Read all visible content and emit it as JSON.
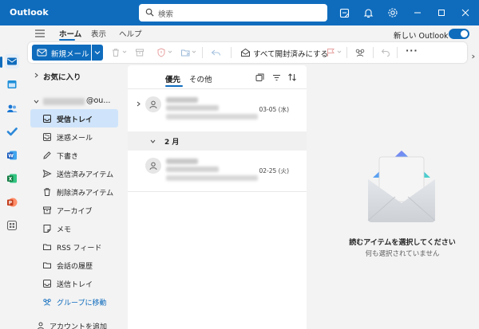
{
  "app": {
    "title": "Outlook"
  },
  "search": {
    "placeholder": "検索"
  },
  "titlebar_icons": [
    "notes-icon",
    "bell-icon",
    "gear-icon"
  ],
  "window_controls": [
    "minimize-icon",
    "maximize-icon",
    "close-icon"
  ],
  "menu": {
    "tabs": [
      {
        "label": "ホーム",
        "active": true
      },
      {
        "label": "表示",
        "active": false
      },
      {
        "label": "ヘルプ",
        "active": false
      }
    ],
    "new_outlook_label": "新しい Outlook",
    "new_outlook_on": true
  },
  "ribbon": {
    "new_mail_label": "新規メール",
    "mark_all_read_label": "すべて開封済みにする",
    "more_label": "···"
  },
  "folders": {
    "favorites_label": "お気に入り",
    "account_suffix": "@ou...",
    "items": [
      {
        "label": "受信トレイ",
        "icon": "inbox-icon",
        "selected": true
      },
      {
        "label": "迷惑メール",
        "icon": "junk-icon",
        "selected": false
      },
      {
        "label": "下書き",
        "icon": "pencil-icon",
        "selected": false
      },
      {
        "label": "送信済みアイテム",
        "icon": "send-icon",
        "selected": false
      },
      {
        "label": "削除済みアイテム",
        "icon": "trash-icon",
        "selected": false
      },
      {
        "label": "アーカイブ",
        "icon": "archive-icon",
        "selected": false
      },
      {
        "label": "メモ",
        "icon": "note-icon",
        "selected": false
      },
      {
        "label": "RSS フィード",
        "icon": "folder-icon",
        "selected": false
      },
      {
        "label": "会話の履歴",
        "icon": "folder-icon",
        "selected": false
      },
      {
        "label": "送信トレイ",
        "icon": "outbox-icon",
        "selected": false
      }
    ],
    "group_move_label": "グループに移動",
    "add_account_label": "アカウントを追加"
  },
  "mail_list": {
    "tabs": [
      {
        "label": "優先",
        "active": true
      },
      {
        "label": "その他",
        "active": false
      }
    ],
    "messages": [
      {
        "date": "03-05 (水)"
      },
      {
        "date": "02-25 (火)"
      }
    ],
    "group_label": "2 月"
  },
  "reading_pane": {
    "title": "読むアイテムを選択してください",
    "subtitle": "何も選択されていません"
  },
  "colors": {
    "accent": "#0f6cbd",
    "selected_folder": "#cfe4fa"
  }
}
